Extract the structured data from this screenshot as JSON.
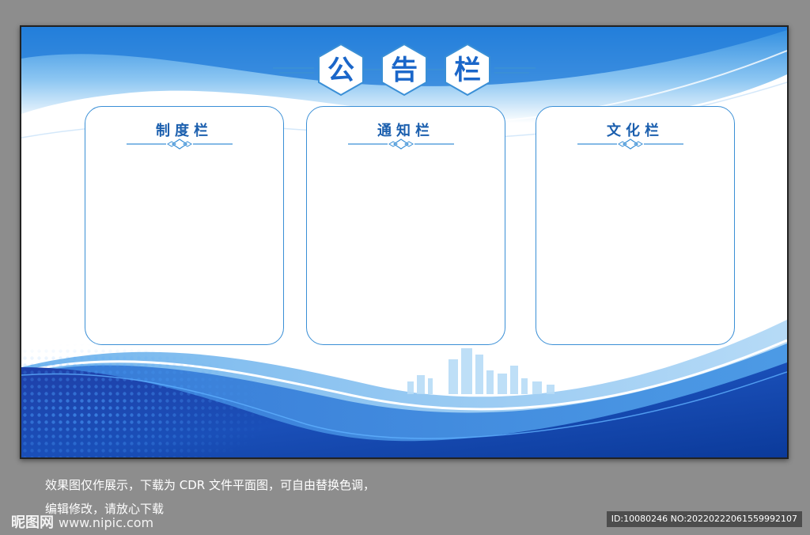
{
  "board": {
    "title_chars": [
      "公",
      "告",
      "栏"
    ],
    "panels": [
      {
        "title": "制度栏"
      },
      {
        "title": "通知栏"
      },
      {
        "title": "文化栏"
      }
    ]
  },
  "colors": {
    "page_bg": "#8d8d8d",
    "accent_blue": "#1a66c9",
    "dark_blue": "#0f3f9e",
    "light_blue": "#a9d4f5"
  },
  "caption": {
    "line1": "效果图仅作展示，下载为 CDR 文件平面图，可自由替换色调，",
    "line2": "编辑修改，请放心下载"
  },
  "watermark": {
    "brand": "昵图网",
    "url": "www.nipic.com"
  },
  "id_bar": {
    "text": "ID:10080246 NO:20220222061559992107"
  }
}
